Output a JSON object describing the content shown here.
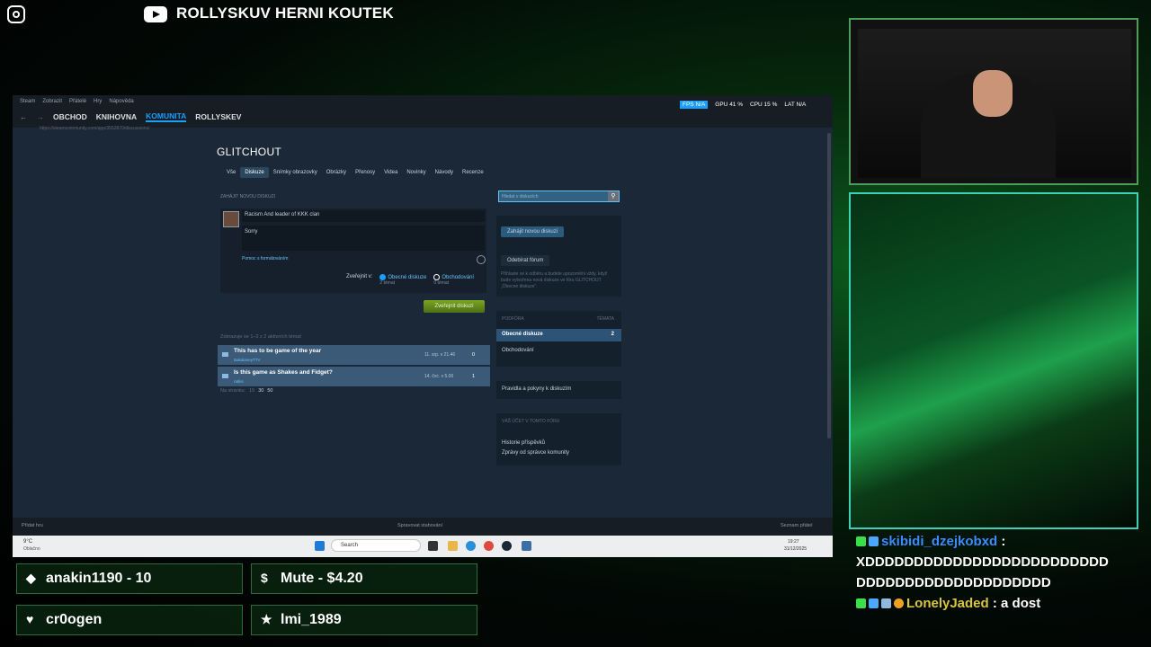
{
  "stream": {
    "channel_title": "ROLLYSKUV HERNI KOUTEK",
    "icons": [
      "instagram-icon",
      "youtube-icon"
    ]
  },
  "steam": {
    "menu": [
      "Steam",
      "Zobrazit",
      "Přátelé",
      "Hry",
      "Nápověda"
    ],
    "nav": [
      "OBCHOD",
      "KNIHOVNA",
      "KOMUNITA",
      "ROLLYSKEV"
    ],
    "active_nav": "KOMUNITA",
    "url": "https://steamcommunity.com/app/3552870/discussions/",
    "perf": [
      "FPS N/A",
      "GPU 41 %",
      "CPU 15 %",
      "LAT N/A"
    ],
    "game_title": "GLITCHOUT",
    "tabs": [
      "Vše",
      "Diskuze",
      "Snímky obrazovky",
      "Obrázky",
      "Přenosy",
      "Videa",
      "Novinky",
      "Návody",
      "Recenze"
    ],
    "active_tab": "Diskuze",
    "start_label": "ZAHÁJIT NOVOU DISKUZI",
    "compose_title": "Racism And leader of KKK clan",
    "compose_body": "Sorry",
    "format_help": "Pomoc s formátováním",
    "publish_in": "Zveřejnit v:",
    "opt_general": "Obecné diskuze",
    "opt_general_count": "2 témat",
    "opt_trading": "Obchodování",
    "opt_trading_count": "0 témat",
    "publish_button": "Zveřejnit diskuzi",
    "shown_text": "Zobrazuje se 1–2 z 2 aktivních témat",
    "topics": [
      {
        "title": "This has to be game of the year",
        "author": "BakalaneyTTV",
        "date": "11. srp. v 21.46",
        "count": "0"
      },
      {
        "title": "Is this game as Shakes and Fidget?",
        "author": "ratiks",
        "date": "14. čvc. v 5.00",
        "count": "1"
      }
    ],
    "per_page_label": "Na stránku:",
    "per_page": [
      "15",
      "30",
      "50"
    ],
    "search_placeholder": "Hledat v diskuzích",
    "start_button": "Zahájit novou diskuzi",
    "subscribe_button": "Odebírat fórum",
    "subscribe_text": "Přihlaste se k odběru a budete upozorněni vždy, když bude vytvořena nová diskuze ve fóru GLITCHOUT „Obecné diskuze“.",
    "forum_head": "PODFÓRA",
    "topics_head": "TÉMATA",
    "forum_general": "Obecné diskuze",
    "forum_general_count": "2",
    "forum_trading": "Obchodování",
    "rules": "Pravidla a pokyny k diskuzím",
    "account_head": "VÁŠ ÚČET V TOMTO FÓRU",
    "history": "Historie příspěvků",
    "mod_msgs": "Zprávy od správce komunity",
    "add_game": "Přidat hru",
    "downloads": "Spravovat stahování",
    "friends": "Seznam přátel"
  },
  "taskbar": {
    "weather_temp": "9°C",
    "weather_desc": "Oblačno",
    "search": "Search",
    "time": "19:27",
    "date": "31/12/2025"
  },
  "chat": [
    {
      "user": "skibidi_dzejkobxd",
      "message": "XDDDDDDDDDDDDDDDDDDDDDDDDDDDDDDDDDDDDDDDDDDDDD"
    },
    {
      "user": "LonelyJaded",
      "message": "a dost"
    }
  ],
  "alerts": [
    {
      "icon": "diamond-icon",
      "text": "anakin1190 - 10"
    },
    {
      "icon": "dollar-icon",
      "text": "Mute - $4.20"
    },
    {
      "icon": "heart-icon",
      "text": "cr0ogen"
    },
    {
      "icon": "star-icon",
      "text": "lmi_1989"
    }
  ]
}
